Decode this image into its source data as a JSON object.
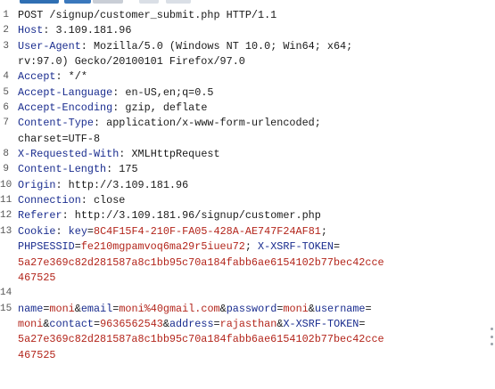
{
  "tabs_strip": {
    "colors": [
      "#2f6fb3",
      "#3a78bd",
      "#c9ced6",
      "#dadfe6",
      "#dadfe6"
    ]
  },
  "request": {
    "line_numbers": [
      "1",
      "2",
      "3",
      "",
      "4",
      "5",
      "6",
      "7",
      "",
      "8",
      "9",
      "10",
      "11",
      "12",
      "13",
      "",
      "",
      "",
      "14",
      "15",
      "",
      "",
      ""
    ],
    "line1": "POST /signup/customer_submit.php HTTP/1.1",
    "host_key": "Host",
    "host_value": "3.109.181.96",
    "ua_key": "User-Agent",
    "ua_value_1": "Mozilla/5.0 (Windows NT 10.0; Win64; x64;",
    "ua_value_2": "rv:97.0) Gecko/20100101 Firefox/97.0",
    "accept_key": "Accept",
    "accept_value": "*/*",
    "accept_lang_key": "Accept-Language",
    "accept_lang_value": "en-US,en;q=0.5",
    "accept_enc_key": "Accept-Encoding",
    "accept_enc_value": "gzip, deflate",
    "ctype_key": "Content-Type",
    "ctype_value_1": "application/x-www-form-urlencoded;",
    "ctype_value_2": "charset=UTF-8",
    "xrw_key": "X-Requested-With",
    "xrw_value": "XMLHttpRequest",
    "clen_key": "Content-Length",
    "clen_value": "175",
    "origin_key": "Origin",
    "origin_value": "http://3.109.181.96",
    "conn_key": "Connection",
    "conn_value": "close",
    "referer_key": "Referer",
    "referer_value": "http://3.109.181.96/signup/customer.php",
    "cookie_key": "Cookie",
    "cookie_key_name": "key",
    "cookie_key_val": "8C4F15F4-210F-FA05-428A-AE747F24AF81",
    "cookie_sess_name": "PHPSESSID",
    "cookie_sess_val": "fe210mgpamvoq6ma29r5iueu72",
    "cookie_xsrf_name": "X-XSRF-TOKEN",
    "cookie_xsrf_val_1": "5a27e369c82d281587a8c1bb95c70a184fabb6ae6154102b77bec42cce",
    "cookie_xsrf_val_2": "467525",
    "body_name_k": "name",
    "body_name_v": "moni",
    "body_email_k": "email",
    "body_email_v": "moni%40gmail.com",
    "body_pass_k": "password",
    "body_pass_v": "moni",
    "body_user_k": "username",
    "body_user_v": "moni",
    "body_contact_k": "contact",
    "body_contact_v": "9636562543",
    "body_addr_k": "address",
    "body_addr_v": "rajasthan",
    "body_xsrf_k": "X-XSRF-TOKEN",
    "body_xsrf_v_1": "5a27e369c82d281587a8c1bb95c70a184fabb6ae6154102b77bec42cce",
    "body_xsrf_v_2": "467525"
  }
}
